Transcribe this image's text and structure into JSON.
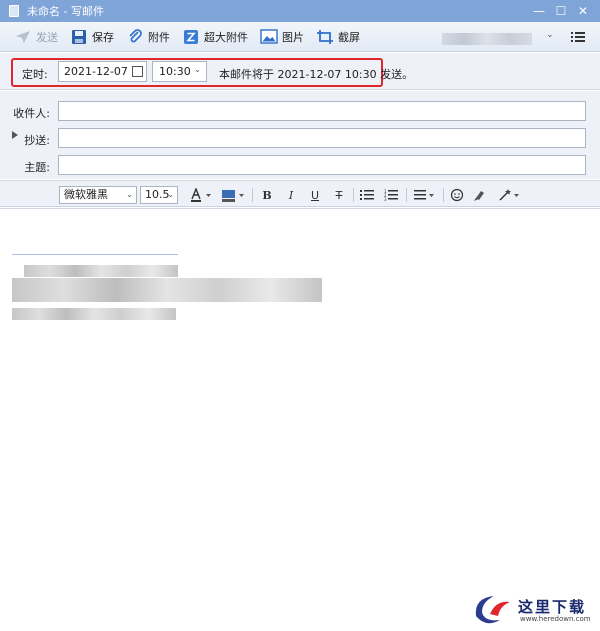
{
  "window": {
    "title": "未命名 - 写邮件",
    "minimize": "—",
    "maximize": "☐",
    "close": "✕"
  },
  "toolbar": {
    "items": [
      {
        "label": "发送",
        "icon": "send-icon",
        "enabled": false
      },
      {
        "label": "保存",
        "icon": "save-icon",
        "enabled": true
      },
      {
        "label": "附件",
        "icon": "paperclip-icon",
        "enabled": true
      },
      {
        "label": "超大附件",
        "icon": "large-attachment-icon",
        "enabled": true
      },
      {
        "label": "图片",
        "icon": "image-icon",
        "enabled": true
      },
      {
        "label": "截屏",
        "icon": "screenshot-icon",
        "enabled": true
      }
    ]
  },
  "schedule": {
    "label": "定时:",
    "date": "2021-12-07",
    "time": "10:30",
    "note": "本邮件将于 2021-12-07 10:30 发送。"
  },
  "fields": {
    "to_label": "收件人:",
    "cc_label": "抄送:",
    "subject_label": "主题:",
    "to_value": "",
    "cc_value": "",
    "subject_value": ""
  },
  "format": {
    "font": "微软雅黑",
    "size": "10.5",
    "bold": "B",
    "italic": "I",
    "underline": "U",
    "strike": "T"
  },
  "watermark": {
    "brand": "这里下载",
    "url": "www.heredown.com"
  },
  "colors": {
    "titlebar": "#7fa4d8",
    "highlight_frame": "#e0262b",
    "accent_blue": "#2f6fc9"
  }
}
